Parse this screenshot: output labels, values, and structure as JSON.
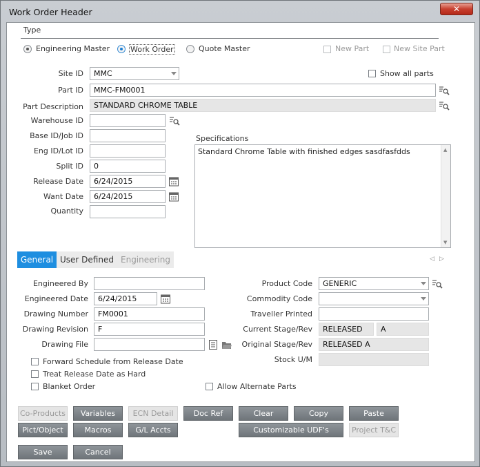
{
  "window": {
    "title": "Work Order Header"
  },
  "type_section": {
    "label": "Type",
    "options": [
      "Engineering Master",
      "Work Order",
      "Quote Master"
    ],
    "selected": "Work Order",
    "new_part": "New Part",
    "new_site_part": "New Site Part"
  },
  "header": {
    "site_id_label": "Site ID",
    "site_id": "MMC",
    "show_all_parts": "Show all parts",
    "part_id_label": "Part ID",
    "part_id": "MMC-FM0001",
    "part_desc_label": "Part Description",
    "part_desc": "STANDARD CHROME TABLE",
    "warehouse_label": "Warehouse ID",
    "warehouse": "",
    "base_label": "Base ID/Job ID",
    "base": "",
    "eng_label": "Eng ID/Lot ID",
    "eng": "",
    "split_label": "Split ID",
    "split": "0",
    "release_label": "Release Date",
    "release": "6/24/2015",
    "want_label": "Want Date",
    "want": "6/24/2015",
    "qty_label": "Quantity",
    "qty": "",
    "spec_label": "Specifications",
    "spec_text": "Standard Chrome Table with finished edges  sasdfasfdds"
  },
  "tabs": [
    "General",
    "User Defined",
    "Engineering"
  ],
  "general": {
    "engineered_by_label": "Engineered By",
    "engineered_by": "",
    "engineered_date_label": "Engineered Date",
    "engineered_date": "6/24/2015",
    "drawing_number_label": "Drawing Number",
    "drawing_number": "FM0001",
    "drawing_revision_label": "Drawing Revision",
    "drawing_revision": "F",
    "drawing_file_label": "Drawing File",
    "drawing_file": "",
    "product_code_label": "Product Code",
    "product_code": "GENERIC",
    "commodity_code_label": "Commodity Code",
    "commodity_code": "",
    "traveller_label": "Traveller Printed",
    "traveller": "",
    "current_stage_label": "Current Stage/Rev",
    "current_stage": "RELEASED",
    "current_rev": "A",
    "original_stage_label": "Original Stage/Rev",
    "original_stage": "RELEASED A",
    "stock_um_label": "Stock U/M",
    "stock_um": "",
    "forward_schedule": "Forward Schedule from Release Date",
    "treat_release": "Treat Release Date as Hard",
    "blanket_order": "Blanket Order",
    "allow_alternate": "Allow Alternate Parts"
  },
  "buttons": {
    "co_products": "Co-Products",
    "variables": "Variables",
    "ecn_detail": "ECN Detail",
    "doc_ref": "Doc Ref",
    "clear": "Clear",
    "copy": "Copy",
    "paste": "Paste",
    "pict_object": "Pict/Object",
    "macros": "Macros",
    "gl_accts": "G/L Accts",
    "customizable_udfs": "Customizable UDF's",
    "project_tc": "Project T&C",
    "save": "Save",
    "cancel": "Cancel"
  },
  "colors": {
    "accent": "#1e8ee0",
    "close": "#c7402f",
    "button": "#7f858a"
  }
}
